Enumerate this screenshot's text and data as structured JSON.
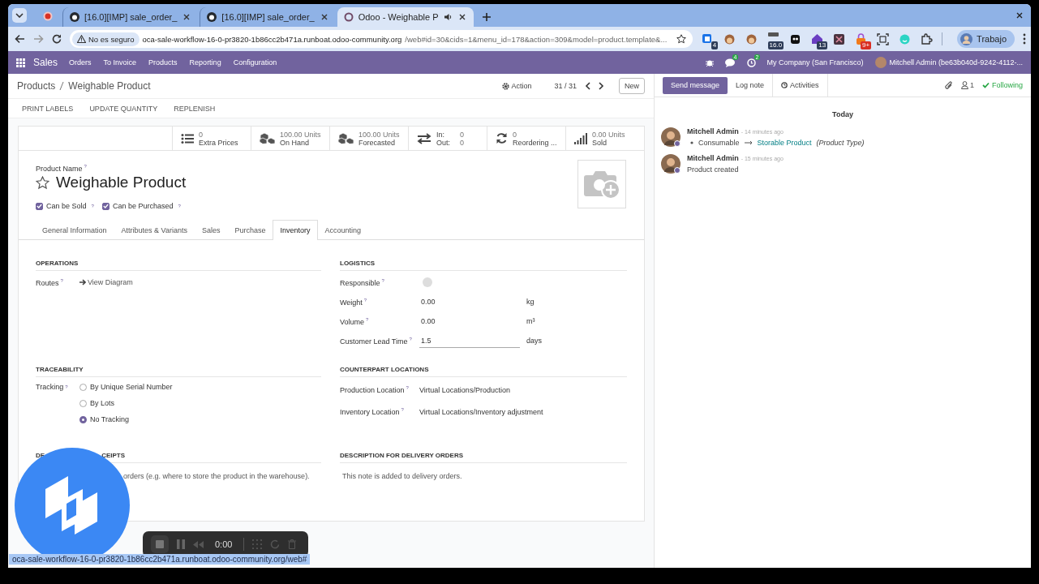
{
  "browser": {
    "tabs": [
      {
        "title": "[16.0][IMP] sale_order_",
        "kind": "github",
        "selected": false,
        "audio": false
      },
      {
        "title": "[16.0][IMP] sale_order_",
        "kind": "github",
        "selected": false,
        "audio": false
      },
      {
        "title": "Odoo - Weighable P",
        "kind": "odoo",
        "selected": true,
        "audio": true
      }
    ],
    "security_label": "No es seguro",
    "url_host": "oca-sale-workflow-16-0-pr3820-1b86cc2b471a.runboat.odoo-community.org",
    "url_path": "/web#id=30&cids=1&menu_id=178&action=309&model=product.template&...",
    "extensions": [
      {
        "kind": "tabs",
        "badge": "4"
      },
      {
        "kind": "face"
      },
      {
        "kind": "face"
      },
      {
        "kind": "tile",
        "badge": "16.0"
      },
      {
        "kind": "ghost"
      },
      {
        "kind": "house",
        "badge": "13"
      },
      {
        "kind": "cross"
      },
      {
        "kind": "lock",
        "badge": "9+"
      },
      {
        "kind": "frame"
      },
      {
        "kind": "smile"
      },
      {
        "kind": "puzzle"
      }
    ],
    "profile": "Trabajo"
  },
  "navbar": {
    "app": "Sales",
    "menus": [
      "Orders",
      "To Invoice",
      "Products",
      "Reporting",
      "Configuration"
    ],
    "messages_badge": "4",
    "activities_badge": "2",
    "company": "My Company (San Francisco)",
    "user": "Mitchell Admin (be63b040d-9242-4112-..."
  },
  "control_panel": {
    "breadcrumb": [
      "Products",
      "Weighable Product"
    ],
    "action": "Action",
    "pager": "31 / 31",
    "new": "New",
    "buttons": [
      "PRINT LABELS",
      "UPDATE QUANTITY",
      "REPLENISH"
    ]
  },
  "smart_buttons": [
    {
      "kind": "list",
      "value": "0",
      "label": "Extra Prices"
    },
    {
      "kind": "cubes",
      "value": "100.00 Units",
      "label": "On Hand"
    },
    {
      "kind": "cubes",
      "value": "100.00 Units",
      "label": "Forecasted"
    },
    {
      "kind": "inout",
      "in_label": "In:",
      "in_value": "0",
      "out_label": "Out:",
      "out_value": "0"
    },
    {
      "kind": "refresh",
      "value": "0",
      "label": "Reordering ..."
    },
    {
      "kind": "chart",
      "value": "0.00 Units",
      "label": "Sold"
    }
  ],
  "form": {
    "name_label": "Product Name",
    "name_help": "?",
    "name": "Weighable Product",
    "favorite": false,
    "checkboxes": [
      {
        "label": "Can be Sold",
        "help": "?",
        "checked": true
      },
      {
        "label": "Can be Purchased",
        "help": "?",
        "checked": true
      }
    ],
    "tabs": [
      {
        "label": "General Information",
        "selected": false
      },
      {
        "label": "Attributes & Variants",
        "selected": false
      },
      {
        "label": "Sales",
        "selected": false
      },
      {
        "label": "Purchase",
        "selected": false
      },
      {
        "label": "Inventory",
        "selected": true
      },
      {
        "label": "Accounting",
        "selected": false
      }
    ],
    "operations": {
      "title": "OPERATIONS",
      "routes_label": "Routes",
      "routes_help": "?",
      "link": "View Diagram"
    },
    "logistics": {
      "title": "LOGISTICS",
      "fields": [
        {
          "kind": "avatar",
          "label": "Responsible",
          "help": "?"
        },
        {
          "kind": "number",
          "label": "Weight",
          "help": "?",
          "value": "0.00",
          "unit": "kg"
        },
        {
          "kind": "number",
          "label": "Volume",
          "help": "?",
          "value": "0.00",
          "unit": "m³"
        },
        {
          "kind": "focused",
          "label": "Customer Lead Time",
          "help": "?",
          "value": "1.5",
          "unit": "days"
        }
      ]
    },
    "traceability": {
      "title": "TRACEABILITY",
      "label": "Tracking",
      "help": "?",
      "options": [
        {
          "label": "By Unique Serial Number",
          "selected": false
        },
        {
          "label": "By Lots",
          "selected": false
        },
        {
          "label": "No Tracking",
          "selected": true
        }
      ]
    },
    "counterpart": {
      "title": "COUNTERPART LOCATIONS",
      "fields": [
        {
          "label": "Production Location",
          "help": "?",
          "value": "Virtual Locations/Production"
        },
        {
          "label": "Inventory Location",
          "help": "?",
          "value": "Virtual Locations/Inventory adjustment"
        }
      ]
    },
    "receipts": {
      "title_parts": [
        "DE",
        "CEIPTS"
      ],
      "note": "orders (e.g. where to store the product in the warehouse)."
    },
    "delivery": {
      "title": "DESCRIPTION FOR DELIVERY ORDERS",
      "note": "This note is added to delivery orders."
    }
  },
  "chatter": {
    "buttons": [
      {
        "label": "Send message",
        "primary": true
      },
      {
        "label": "Log note",
        "primary": false
      },
      {
        "label": "Activities",
        "primary": false
      }
    ],
    "followers": "1",
    "following": "Following",
    "date": "Today",
    "messages": [
      {
        "kind": "tracking",
        "author": "Mitchell Admin",
        "time": "- 14 minutes ago",
        "old": "Consumable",
        "new": "Storable Product",
        "field": "(Product Type)"
      },
      {
        "kind": "text",
        "author": "Mitchell Admin",
        "time": "- 15 minutes ago",
        "body": "Product created"
      }
    ]
  },
  "recorder": {
    "time": "0:00"
  },
  "status_url": "oca-sale-workflow-16-0-pr3820-1b86cc2b471a.runboat.odoo-community.org/web#"
}
